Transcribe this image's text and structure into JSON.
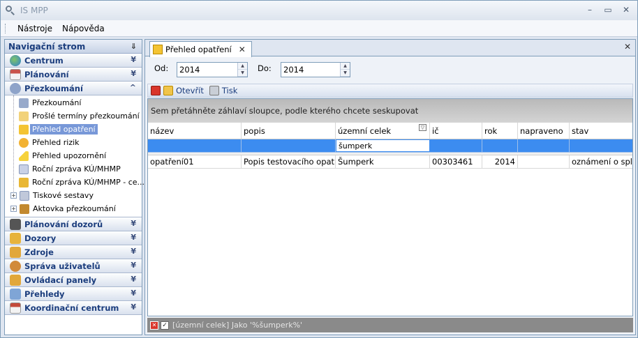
{
  "window": {
    "title": "IS MPP",
    "minimize": "–",
    "maximize": "▭",
    "close": "✕"
  },
  "menu": [
    "Nástroje",
    "Nápověda"
  ],
  "nav": {
    "title": "Navigační strom",
    "pin": "⇓",
    "top_groups": [
      {
        "label": "Centrum",
        "chev": "¥",
        "color": "#2d7fd1"
      },
      {
        "label": "Plánování",
        "chev": "¥",
        "color": "#c9544a"
      },
      {
        "label": "Přezkoumání",
        "chev": "^",
        "color": "#8ea3c9"
      }
    ],
    "tree_items": [
      {
        "label": "Přezkoumání",
        "color": "#98aacb"
      },
      {
        "label": "Prošlé termíny přezkoumání",
        "color": "#f2d27a"
      },
      {
        "label": "Přehled opatření",
        "color": "#f4c433"
      },
      {
        "label": "Přehled rizik",
        "color": "#f2b233"
      },
      {
        "label": "Přehled upozornění",
        "color": "#f6d23c"
      },
      {
        "label": "Roční zpráva KÚ/MHMP",
        "color": "#c9d1e6"
      },
      {
        "label": "Roční zpráva KÚ/MHMP - ce...",
        "color": "#e9b734"
      },
      {
        "label": "Tiskové sestavy",
        "color": "#c0c8da"
      },
      {
        "label": "Aktovka přezkoumání",
        "color": "#c3892f"
      }
    ],
    "bottom_groups": [
      {
        "label": "Plánování dozorů",
        "chev": "¥",
        "color": "#555"
      },
      {
        "label": "Dozory",
        "chev": "¥",
        "color": "#e7b33c"
      },
      {
        "label": "Zdroje",
        "chev": "¥",
        "color": "#e1a73a"
      },
      {
        "label": "Správa uživatelů",
        "chev": "¥",
        "color": "#d18a3a"
      },
      {
        "label": "Ovládací panely",
        "chev": "¥",
        "color": "#e1a73a"
      },
      {
        "label": "Přehledy",
        "chev": "¥",
        "color": "#7fa5d6"
      },
      {
        "label": "Koordinační centrum",
        "chev": "¥",
        "color": "#c34a3a"
      }
    ]
  },
  "tab": {
    "label": "Přehled opatření",
    "close": "✕"
  },
  "doc_close": "✕",
  "filters": {
    "from_label": "Od:",
    "from_value": "2014",
    "to_label": "Do:",
    "to_value": "2014"
  },
  "toolbar": {
    "open_label": "Otevřít",
    "print_label": "Tisk"
  },
  "grid": {
    "groupby_hint": "Sem přetáhněte záhlaví sloupce, podle kterého chcete seskupovat",
    "columns": [
      "název",
      "popis",
      "územní celek",
      "ič",
      "rok",
      "napraveno",
      "stav"
    ],
    "autofilter_value": "šumperk",
    "rows": [
      [
        "opatření01",
        "Popis testovacího opatření",
        "Šumperk",
        "00303461",
        "2014",
        "",
        "oznámení o spl..."
      ]
    ]
  },
  "filter_expression": "[územní celek] Jako '%šumperk%'"
}
